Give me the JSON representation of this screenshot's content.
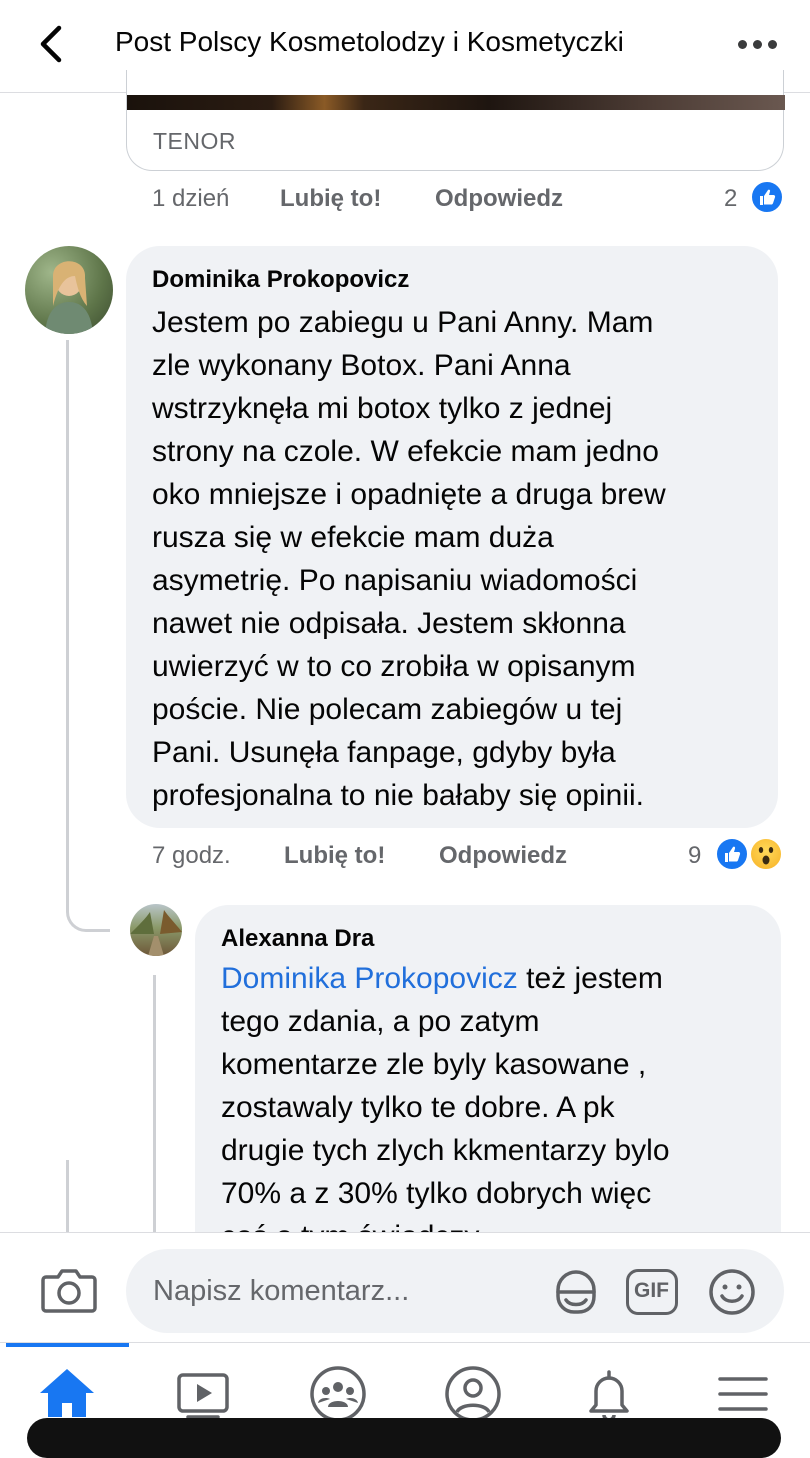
{
  "header": {
    "title": "Post Polscy Kosmetolodzy i Kosmetyczki",
    "back_icon": "chevron-left-icon",
    "more_icon": "more-horizontal-icon"
  },
  "previous_comment": {
    "attachment_source": "TENOR",
    "time": "1 dzień",
    "like_label": "Lubię to!",
    "reply_label": "Odpowiedz",
    "reaction_count": "2",
    "reactions": [
      "like"
    ]
  },
  "comment": {
    "author": "Dominika Prokopovicz",
    "lines": [
      "Jestem po zabiegu u Pani Anny. Mam",
      "zle wykonany Botox. Pani Anna",
      "wstrzyknęła mi botox tylko z jednej",
      "strony na czole. W efekcie mam jedno",
      "oko mniejsze i opadnięte a druga brew",
      "rusza się w efekcie mam duża",
      "asymetrię. Po napisaniu wiadomości",
      "nawet nie odpisała. Jestem skłonna",
      "uwierzyć w to co zrobiła w opisanym",
      "poście. Nie polecam zabiegów u tej",
      "Pani. Usunęła fanpage, gdyby była",
      "profesjonalna to nie bałaby się opinii."
    ],
    "time": "7 godz.",
    "like_label": "Lubię to!",
    "reply_label": "Odpowiedz",
    "reaction_count": "9",
    "reactions": [
      "like",
      "wow"
    ]
  },
  "reply": {
    "author": "Alexanna Dra",
    "mention": "Dominika Prokopovicz",
    "first_line_rest": " też jestem",
    "lines": [
      "tego zdania, a po zatym",
      "komentarze zle byly kasowane ,",
      "zostawaly tylko te dobre. A pk",
      "drugie tych zlych kkmentarzy bylo",
      "70% a z 30% tylko dobrych więc",
      "coś o tym świadczy"
    ]
  },
  "composer": {
    "placeholder": "Napisz komentarz...",
    "gif_label": "GIF",
    "icons": [
      "camera-icon",
      "sticker-icon",
      "gif-icon",
      "emoji-icon"
    ]
  },
  "tabbar": {
    "active": "home",
    "icons": [
      "home-icon",
      "watch-icon",
      "groups-icon",
      "profile-icon",
      "notifications-icon",
      "menu-icon"
    ]
  },
  "colors": {
    "accent": "#1877f2",
    "bubble": "#f0f2f5",
    "secondary_text": "#65676b",
    "mention": "#216fdb"
  }
}
